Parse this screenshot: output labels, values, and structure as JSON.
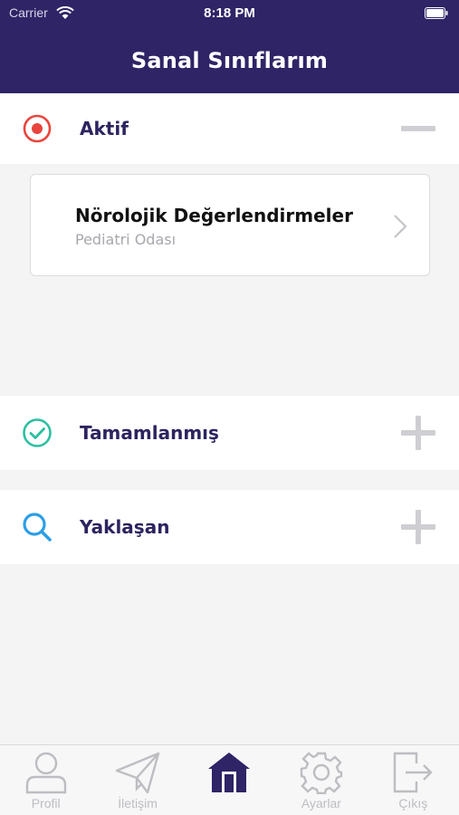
{
  "status_bar": {
    "carrier": "Carrier",
    "time": "8:18 PM",
    "wifi_icon": "wifi-icon",
    "battery_icon": "battery-icon"
  },
  "header": {
    "title": "Sanal Sınıflarım"
  },
  "sections": [
    {
      "label": "Aktif",
      "icon": "radio-target-icon",
      "toggle": "minus-icon",
      "expanded": true,
      "accent": "#e8453c"
    },
    {
      "label": "Tamamlanmış",
      "icon": "check-circle-icon",
      "toggle": "plus-icon",
      "expanded": false,
      "accent": "#2bc0a0"
    },
    {
      "label": "Yaklaşan",
      "icon": "search-icon",
      "toggle": "plus-icon",
      "expanded": false,
      "accent": "#2c9fe6"
    }
  ],
  "active_classes": [
    {
      "title": "Nörolojik Değerlendirmeler",
      "subtitle": "Pediatri Odası",
      "icon": "chevron-right-icon"
    }
  ],
  "tab_bar": {
    "tabs": [
      {
        "label": "Profil",
        "icon": "user-icon",
        "active": false
      },
      {
        "label": "İletişim",
        "icon": "paper-plane-icon",
        "active": false
      },
      {
        "label": "",
        "icon": "home-icon",
        "active": true
      },
      {
        "label": "Ayarlar",
        "icon": "gear-icon",
        "active": false
      },
      {
        "label": "Çıkış",
        "icon": "logout-icon",
        "active": false
      }
    ]
  },
  "colors": {
    "brand": "#2e2466",
    "background": "#f4f4f5",
    "inactive_tab": "#bdbdc2"
  }
}
